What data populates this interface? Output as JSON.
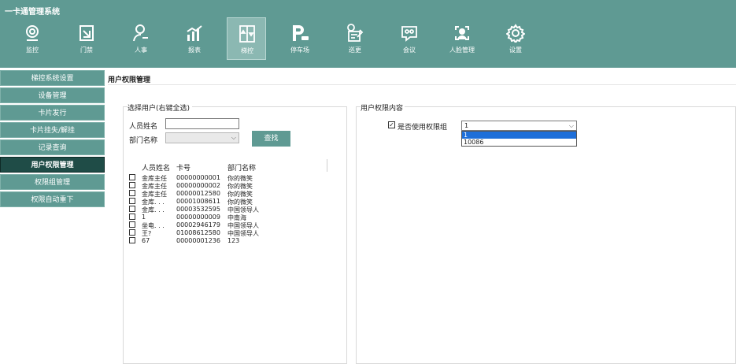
{
  "app": {
    "title": "一卡通管理系统"
  },
  "toolbar": [
    {
      "label": "监控",
      "icon": "webcam-icon"
    },
    {
      "label": "门禁",
      "icon": "door-icon"
    },
    {
      "label": "人事",
      "icon": "person-icon"
    },
    {
      "label": "报表",
      "icon": "chart-icon"
    },
    {
      "label": "梯控",
      "icon": "elevator-icon",
      "active": true
    },
    {
      "label": "停车场",
      "icon": "parking-icon"
    },
    {
      "label": "巡更",
      "icon": "patrol-icon"
    },
    {
      "label": "会议",
      "icon": "meeting-icon"
    },
    {
      "label": "人脸管理",
      "icon": "face-icon"
    },
    {
      "label": "设置",
      "icon": "gear-icon"
    }
  ],
  "sidebar": [
    {
      "label": "梯控系统设置"
    },
    {
      "label": "设备管理"
    },
    {
      "label": "卡片发行"
    },
    {
      "label": "卡片挂失/解挂"
    },
    {
      "label": "记录查询"
    },
    {
      "label": "用户权限管理",
      "active": true
    },
    {
      "label": "权限组管理"
    },
    {
      "label": "权限自动重下"
    }
  ],
  "page": {
    "title": "用户权限管理"
  },
  "select_user": {
    "legend": "选择用户(右键全选)",
    "name_label": "人员姓名",
    "name_value": "",
    "dept_label": "部门名称",
    "dept_value": "",
    "search_label": "查找"
  },
  "table": {
    "headers": {
      "name": "人员姓名",
      "card": "卡号",
      "dept": "部门名称"
    },
    "rows": [
      {
        "name": "金库主任",
        "card": "00000000001",
        "dept": "你的微笑"
      },
      {
        "name": "金库主任",
        "card": "00000000002",
        "dept": "你的微笑"
      },
      {
        "name": "金库主任",
        "card": "00000012580",
        "dept": "你的微笑"
      },
      {
        "name": "金库. . .",
        "card": "00001008611",
        "dept": "你的微笑"
      },
      {
        "name": "金库. . .",
        "card": "00003532595",
        "dept": "中国领导人"
      },
      {
        "name": "1",
        "card": "00000000009",
        "dept": "中南海"
      },
      {
        "name": "坐电. . .",
        "card": "00002946179",
        "dept": "中国领导人"
      },
      {
        "name": "王?",
        "card": "01008612580",
        "dept": "中国领导人"
      },
      {
        "name": "67",
        "card": "00000001236",
        "dept": "123"
      }
    ]
  },
  "permissions": {
    "legend": "用户权限内容",
    "use_group_label": "是否使用权限组",
    "use_group_checked": "✓",
    "selected_group": "1",
    "options": [
      "1",
      "10086"
    ]
  }
}
